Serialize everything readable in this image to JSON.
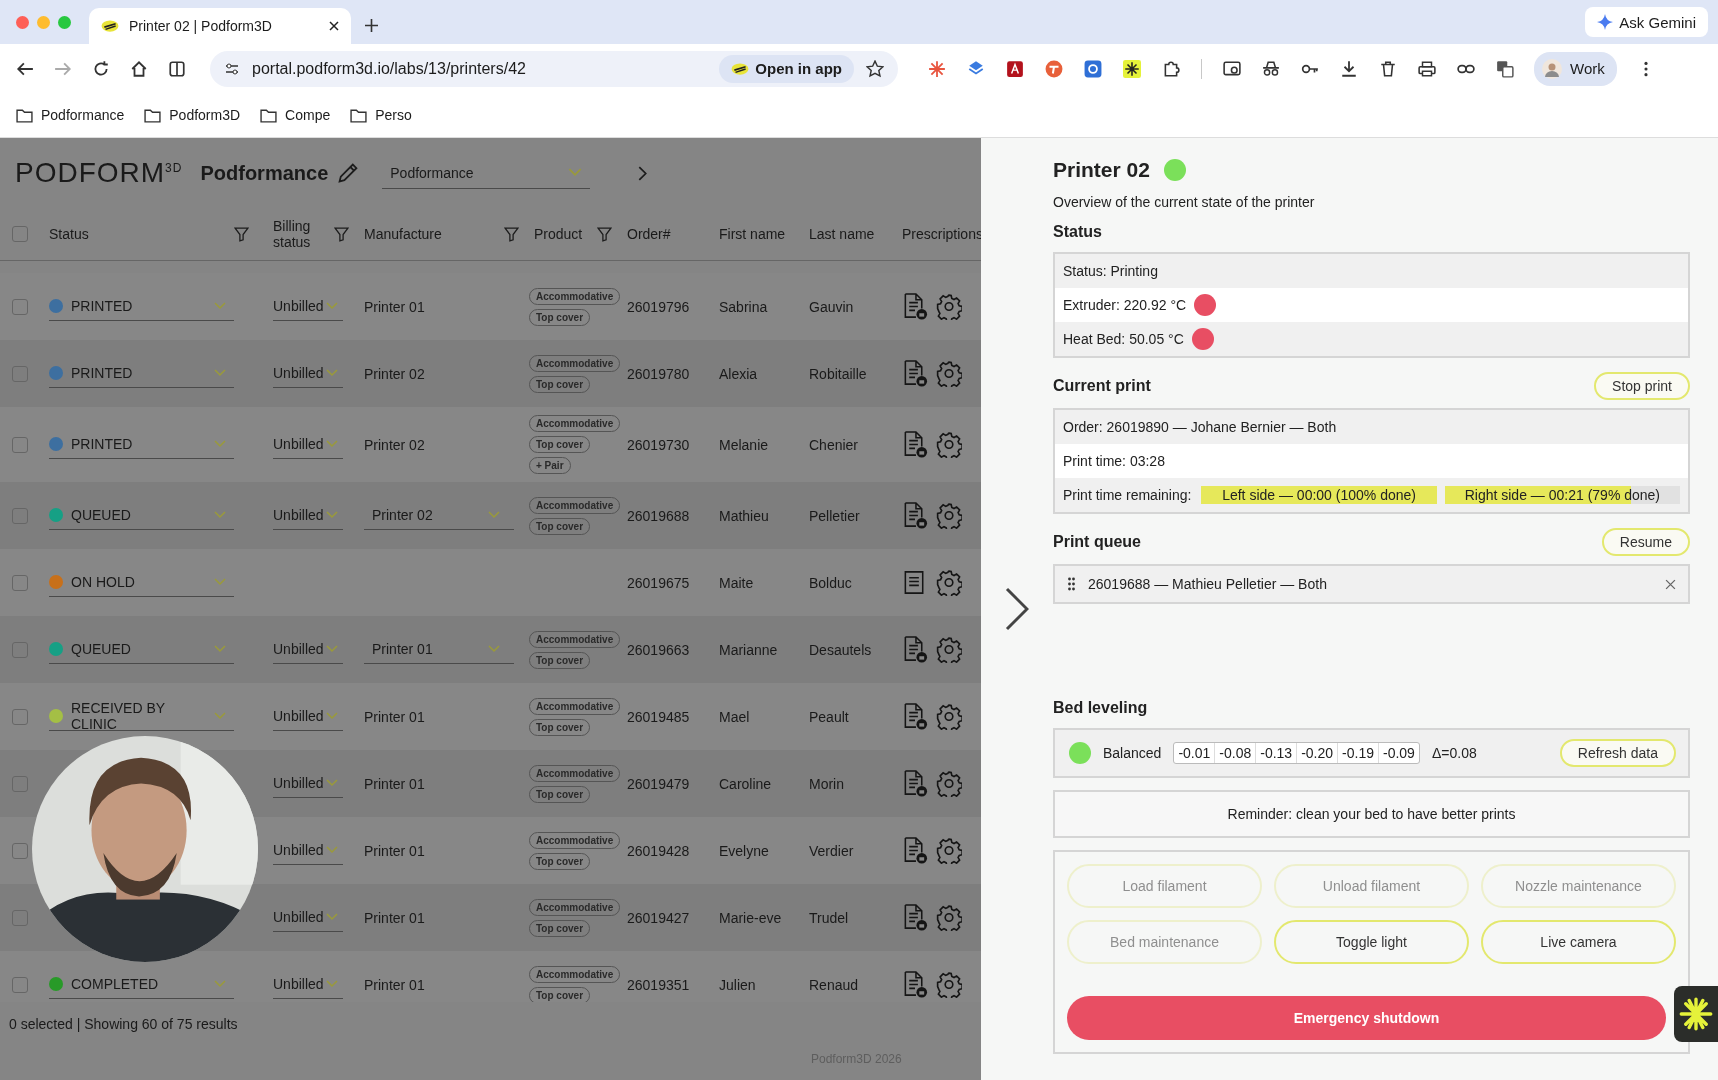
{
  "browser": {
    "tab_title": "Printer 02 | Podform3D",
    "ask_button": "Ask Gemini",
    "url": "portal.podform3d.io/labs/13/printers/42",
    "open_in_app": "Open in app",
    "profile": "Work",
    "bookmarks": [
      "Podformance",
      "Podform3D",
      "Compe",
      "Perso"
    ]
  },
  "header": {
    "logo": "PODFORM$^{3D}$",
    "title": "Podformance",
    "dropdown": "Podformance"
  },
  "table": {
    "select_all": false,
    "columns": [
      {
        "label": "Status",
        "filter": true
      },
      {
        "label": "Billing status",
        "filter": true
      },
      {
        "label": "Manufacture",
        "filter": true
      },
      {
        "label": "Product",
        "filter": true
      },
      {
        "label": "Order#",
        "filter": false
      },
      {
        "label": "First name",
        "filter": false
      },
      {
        "label": "Last name",
        "filter": false
      },
      {
        "label": "Prescriptions",
        "filter": false
      }
    ],
    "rows": [
      {
        "kind": "locked",
        "selected": false,
        "status": {
          "label": "PRINTED",
          "color": "#3d6fa0"
        },
        "billing": "Unbilled",
        "manufacture": {
          "kind": "text",
          "value": "Printer 01"
        },
        "products": [
          "Accommodative",
          "Top cover"
        ],
        "order": "26019796",
        "first_name": "Sabrina",
        "last_name": "Gauvin"
      },
      {
        "kind": "locked",
        "selected": false,
        "status": {
          "label": "PRINTED",
          "color": "#3d6fa0"
        },
        "billing": "Unbilled",
        "manufacture": {
          "kind": "text",
          "value": "Printer 02"
        },
        "products": [
          "Accommodative",
          "Top cover"
        ],
        "order": "26019780",
        "first_name": "Alexia",
        "last_name": "Robitaille"
      },
      {
        "kind": "locked",
        "selected": false,
        "status": {
          "label": "PRINTED",
          "color": "#3d6fa0"
        },
        "billing": "Unbilled",
        "manufacture": {
          "kind": "text",
          "value": "Printer 02"
        },
        "products": [
          "Accommodative",
          "Top cover",
          "+ Pair"
        ],
        "order": "26019730",
        "first_name": "Melanie",
        "last_name": "Chenier"
      },
      {
        "kind": "locked",
        "selected": false,
        "status": {
          "label": "QUEUED",
          "color": "#16a085"
        },
        "billing": "Unbilled",
        "manufacture": {
          "kind": "dropdown",
          "value": "Printer 02"
        },
        "products": [
          "Accommodative",
          "Top cover"
        ],
        "order": "26019688",
        "first_name": "Mathieu",
        "last_name": "Pelletier"
      },
      {
        "kind": "plain",
        "selected": false,
        "status": {
          "label": "ON HOLD",
          "color": "#c8701a"
        },
        "order": "26019675",
        "first_name": "Maite",
        "last_name": "Bolduc"
      },
      {
        "kind": "locked",
        "selected": false,
        "status": {
          "label": "QUEUED",
          "color": "#16a085"
        },
        "billing": "Unbilled",
        "manufacture": {
          "kind": "dropdown",
          "value": "Printer 01"
        },
        "products": [
          "Accommodative",
          "Top cover"
        ],
        "order": "26019663",
        "first_name": "Marianne",
        "last_name": "Desautels"
      },
      {
        "kind": "locked",
        "selected": false,
        "status": {
          "label": "RECEIVED BY CLINIC",
          "color": "#a4bf45"
        },
        "billing": "Unbilled",
        "manufacture": {
          "kind": "text",
          "value": "Printer 01"
        },
        "products": [
          "Accommodative",
          "Top cover"
        ],
        "order": "26019485",
        "first_name": "Mael",
        "last_name": "Peault"
      },
      {
        "kind": "locked",
        "selected": false,
        "billing": "Unbilled",
        "manufacture": {
          "kind": "text",
          "value": "Printer 01"
        },
        "products": [
          "Accommodative",
          "Top cover"
        ],
        "order": "26019479",
        "first_name": "Caroline",
        "last_name": "Morin"
      },
      {
        "kind": "locked",
        "selected": false,
        "billing": "Unbilled",
        "manufacture": {
          "kind": "text",
          "value": "Printer 01"
        },
        "products": [
          "Accommodative",
          "Top cover"
        ],
        "order": "26019428",
        "first_name": "Evelyne",
        "last_name": "Verdier"
      },
      {
        "kind": "locked",
        "selected": false,
        "billing": "Unbilled",
        "manufacture": {
          "kind": "text",
          "value": "Printer 01"
        },
        "products": [
          "Accommodative",
          "Top cover"
        ],
        "order": "26019427",
        "first_name": "Marie-eve",
        "last_name": "Trudel"
      },
      {
        "kind": "locked",
        "selected": false,
        "status": {
          "label": "COMPLETED",
          "color": "#289a28"
        },
        "billing": "Unbilled",
        "manufacture": {
          "kind": "text",
          "value": "Printer 01"
        },
        "products": [
          "Accommodative",
          "Top cover"
        ],
        "order": "26019351",
        "first_name": "Julien",
        "last_name": "Renaud"
      }
    ],
    "summary": "0 selected | Showing 60 of 75 results",
    "footer": "Podform3D 2026"
  },
  "printer": {
    "title": "Printer 02",
    "color": "#7be05a",
    "subtitle": "Overview of the current state of the printer",
    "status": {
      "heading": "Status",
      "rows": [
        {
          "text": "Status: Printing"
        },
        {
          "text": "Extruder: 220.92 °C",
          "color": "#e84e63"
        },
        {
          "text": "Heat Bed: 50.05 °C",
          "color": "#e84e63"
        }
      ]
    },
    "current_print": {
      "heading": "Current print",
      "button": "Stop print",
      "order": "Order: 26019890 — Johane Bernier — Both",
      "print_time": "Print time: 03:28",
      "remaining_label": "Print time remaining:",
      "progress": [
        {
          "text": "Left side — 00:00 (100% done)",
          "level": 1
        },
        {
          "text": "Right side — 00:21 (79% done)",
          "level": 0.79
        }
      ]
    },
    "print_queue": {
      "heading": "Print queue",
      "button": "Resume",
      "items": [
        "26019688 — Mathieu Pelletier — Both"
      ]
    },
    "bed_leveling": {
      "heading": "Bed leveling",
      "color": "#7be05a",
      "state": "Balanced",
      "values": [
        "-0.01",
        "-0.08",
        "-0.13",
        "-0.20",
        "-0.19",
        "-0.09"
      ],
      "delta": "Δ=0.08",
      "button": "Refresh data"
    },
    "reminder": "Reminder: clean your bed to have better prints",
    "actions": [
      {
        "label": "Load filament",
        "disabled": true
      },
      {
        "label": "Unload filament",
        "disabled": true
      },
      {
        "label": "Nozzle maintenance",
        "disabled": true
      },
      {
        "label": "Bed maintenance",
        "disabled": true
      },
      {
        "label": "Toggle light",
        "disabled": false
      },
      {
        "label": "Live camera",
        "disabled": false
      }
    ],
    "emergency": "Emergency shutdown"
  }
}
